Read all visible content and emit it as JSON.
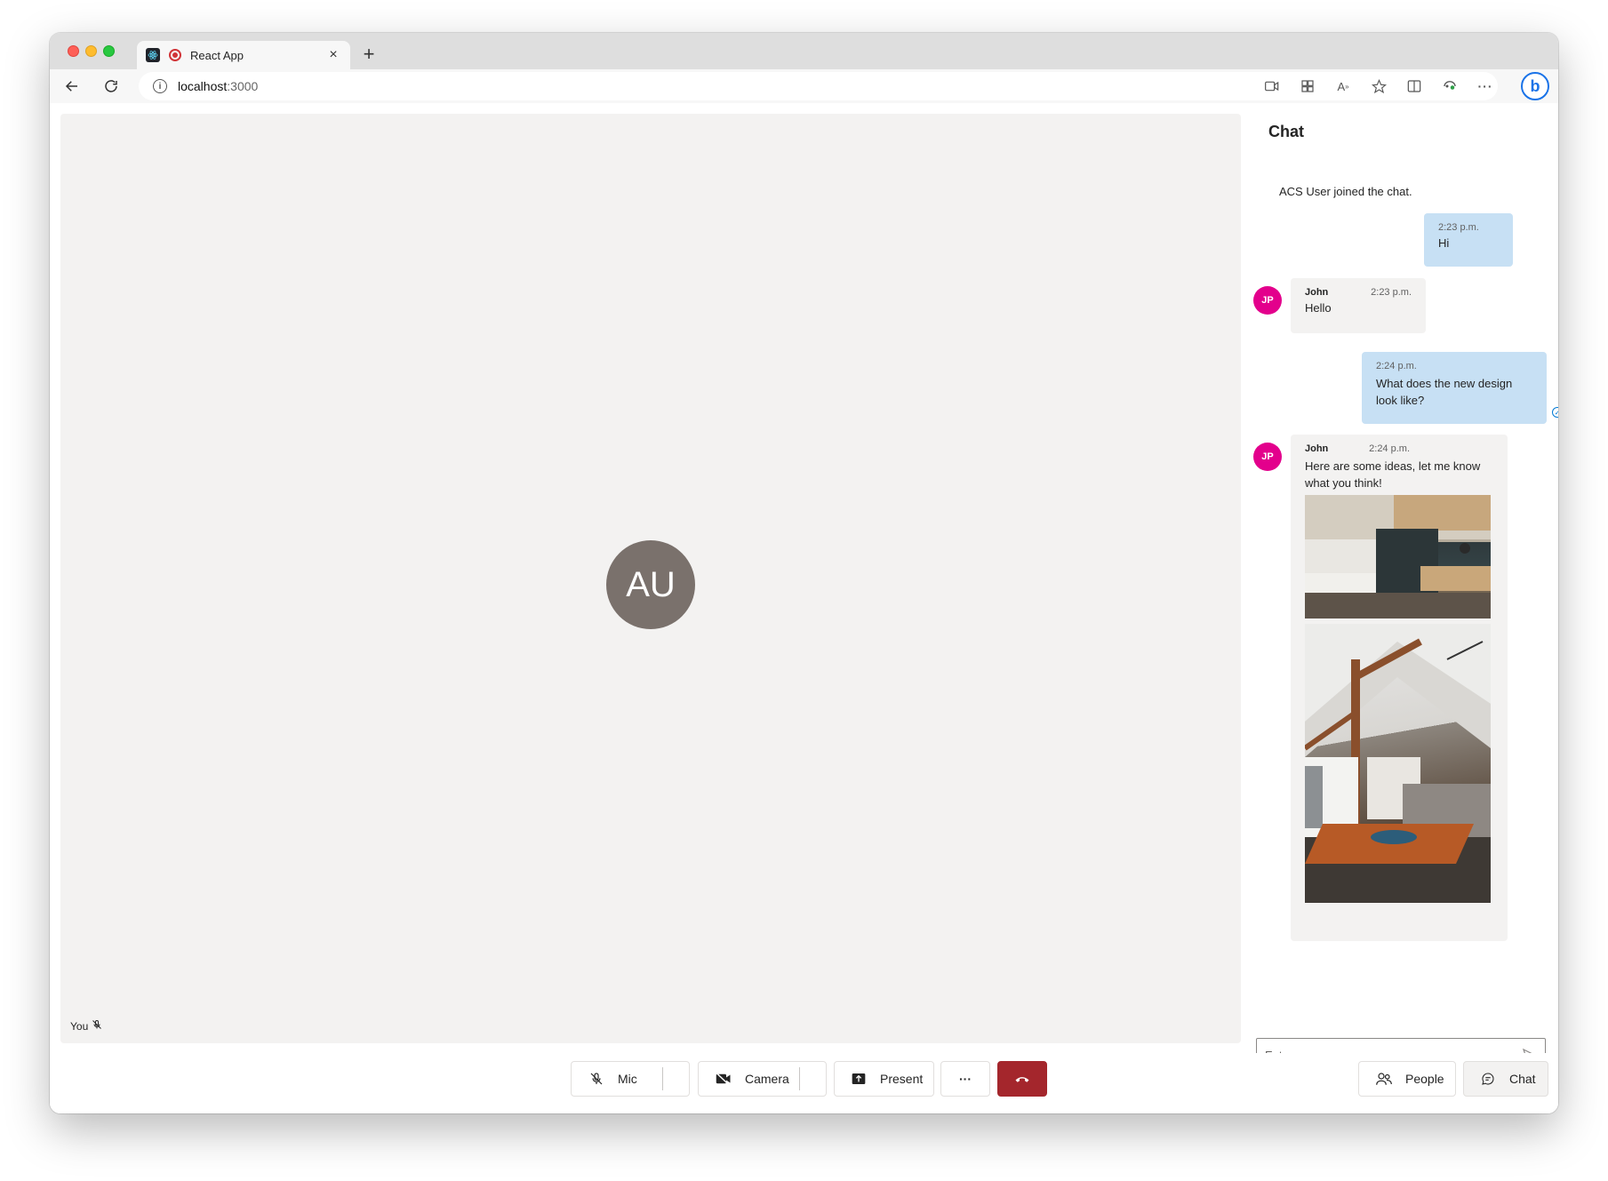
{
  "browser": {
    "tab_title": "React App",
    "tab_close": "×",
    "new_tab": "+",
    "url_host": "localhost",
    "url_port": ":3000",
    "bing_label": "b"
  },
  "stage": {
    "participant_initials": "AU",
    "self_label": "You"
  },
  "chat": {
    "title": "Chat",
    "system_message": "ACS User joined the chat.",
    "messages": [
      {
        "from_me": true,
        "time": "2:23 p.m.",
        "text": "Hi"
      },
      {
        "from_me": false,
        "sender": "John",
        "initials": "JP",
        "time": "2:23 p.m.",
        "text": "Hello"
      },
      {
        "from_me": true,
        "time": "2:24 p.m.",
        "text": "What does the new design look like?"
      },
      {
        "from_me": false,
        "sender": "John",
        "initials": "JP",
        "time": "2:24 p.m.",
        "text": "Here are some ideas, let me know what you think!"
      }
    ],
    "input_placeholder": "Enter a message"
  },
  "controls": {
    "mic": "Mic",
    "camera": "Camera",
    "present": "Present",
    "more": "···",
    "people": "People",
    "chat": "Chat"
  },
  "colors": {
    "my_bubble": "#c7e0f4",
    "their_bubble": "#f3f2f1",
    "avatar_pink": "#e3008c",
    "hangup_red": "#a4262c",
    "stage_bg": "#f3f2f1"
  }
}
